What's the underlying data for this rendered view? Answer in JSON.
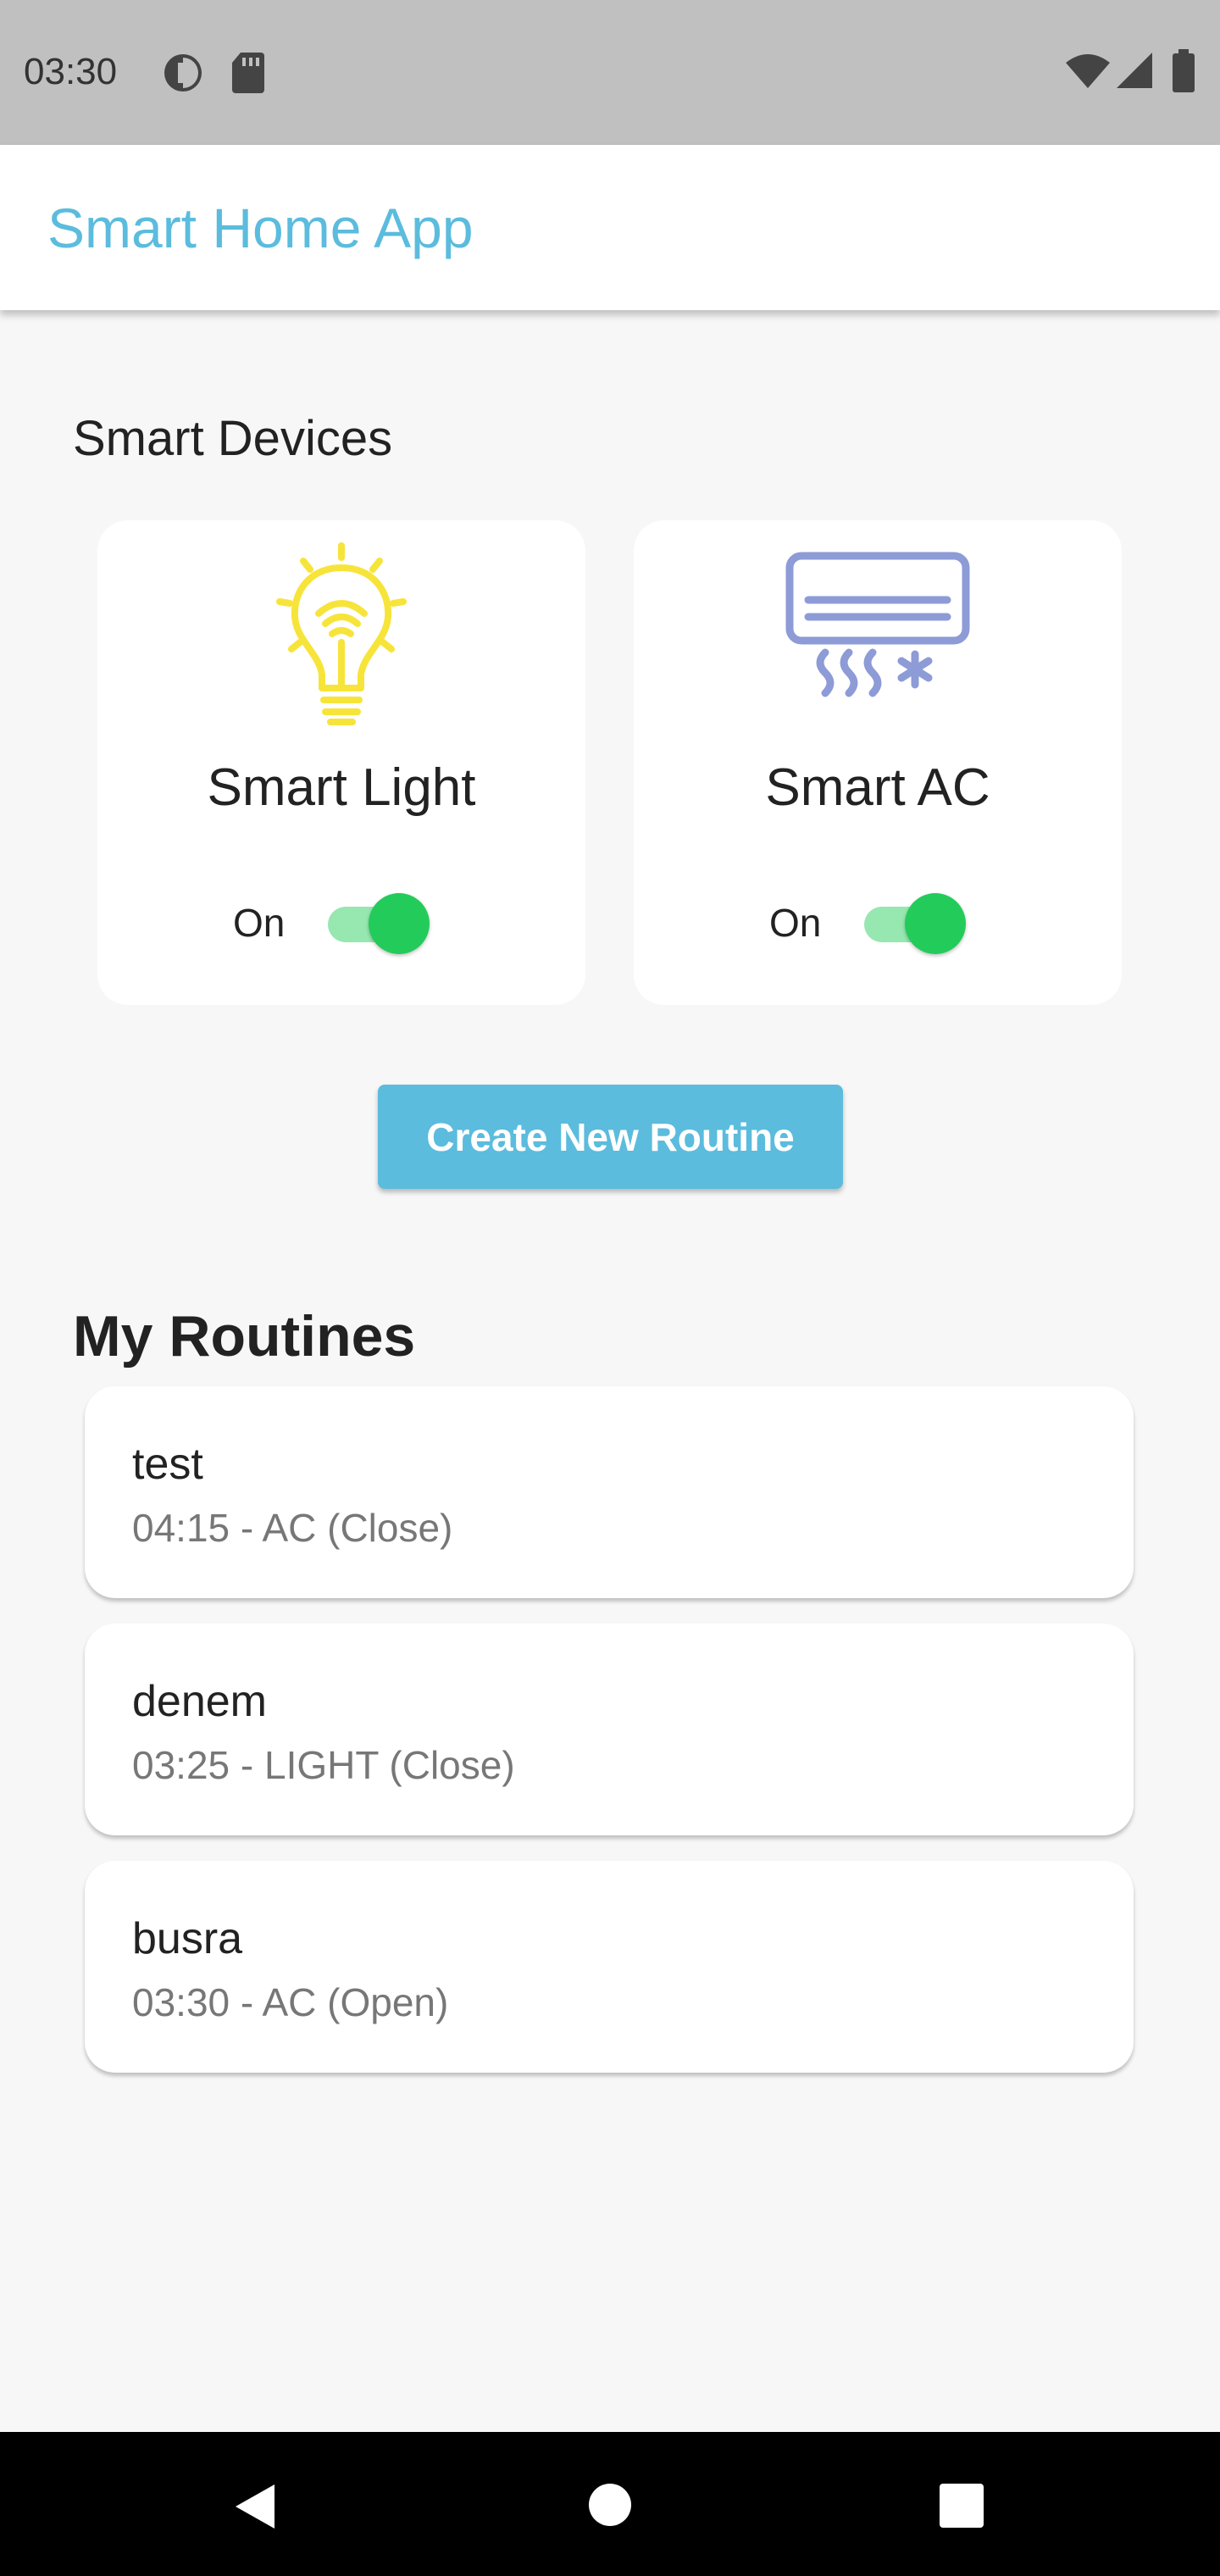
{
  "status_bar": {
    "time": "03:30",
    "icons": [
      "data-saver-icon",
      "sd-card-icon",
      "wifi-icon",
      "signal-icon",
      "battery-icon"
    ]
  },
  "app_bar": {
    "title": "Smart Home App",
    "accent_color": "#5bbcdd"
  },
  "devices_section": {
    "title": "Smart Devices",
    "devices": [
      {
        "name": "Smart Light",
        "icon": "lightbulb-icon",
        "icon_color": "#f7e43a",
        "state_label": "On",
        "on": true
      },
      {
        "name": "Smart AC",
        "icon": "air-conditioner-icon",
        "icon_color": "#8d9bd6",
        "state_label": "On",
        "on": true
      }
    ],
    "toggle_color": "#23cc5a"
  },
  "create_button": {
    "label": "Create New Routine"
  },
  "routines_section": {
    "title": "My Routines",
    "routines": [
      {
        "name": "test",
        "detail": "04:15 - AC (Close)"
      },
      {
        "name": "denem",
        "detail": "03:25 - LIGHT (Close)"
      },
      {
        "name": "busra",
        "detail": "03:30 - AC (Open)"
      }
    ]
  },
  "nav_bar": {
    "icons": [
      "back-icon",
      "home-icon",
      "recents-icon"
    ]
  }
}
